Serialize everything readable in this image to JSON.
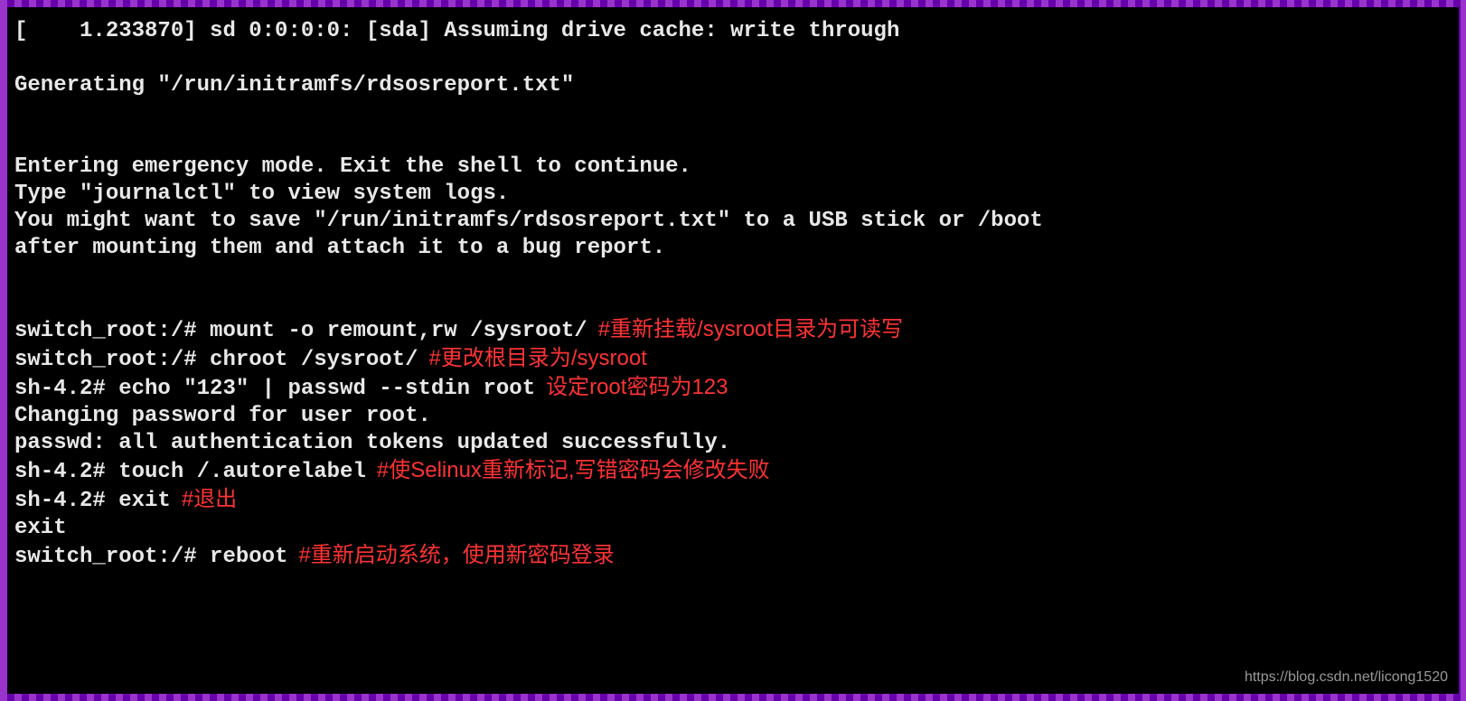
{
  "lines": {
    "l1": "[    1.233870] sd 0:0:0:0: [sda] Assuming drive cache: write through",
    "l2": "",
    "l3": "Generating \"/run/initramfs/rdsosreport.txt\"",
    "l4": "",
    "l5": "",
    "l6": "Entering emergency mode. Exit the shell to continue.",
    "l7": "Type \"journalctl\" to view system logs.",
    "l8": "You might want to save \"/run/initramfs/rdsosreport.txt\" to a USB stick or /boot",
    "l9": "after mounting them and attach it to a bug report.",
    "l10": "",
    "l11": "",
    "l12": "switch_root:/# mount -o remount,rw /sysroot/",
    "l13": "switch_root:/# chroot /sysroot/",
    "l14": "sh-4.2# echo \"123\" | passwd --stdin root",
    "l15": "Changing password for user root.",
    "l16": "passwd: all authentication tokens updated successfully.",
    "l17": "sh-4.2# touch /.autorelabel",
    "l18": "sh-4.2# exit",
    "l19": "exit",
    "l20": "switch_root:/# reboot"
  },
  "annotations": {
    "a12": "#重新挂载/sysroot目录为可读写",
    "a13": "#更改根目录为/sysroot",
    "a14": "设定root密码为123",
    "a17": "#使Selinux重新标记,写错密码会修改失败",
    "a18": "#退出",
    "a20": "#重新启动系统，使用新密码登录"
  },
  "watermark": "https://blog.csdn.net/licong1520"
}
